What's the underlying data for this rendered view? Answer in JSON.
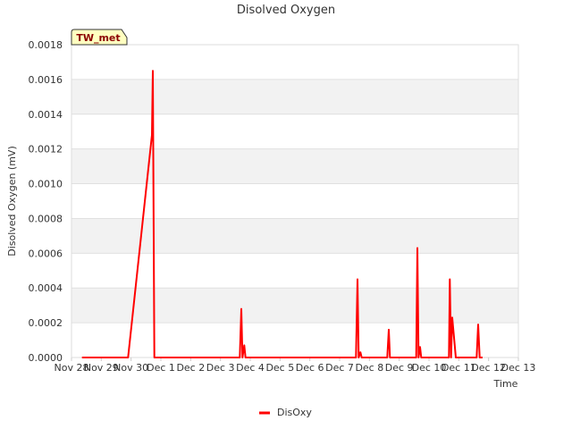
{
  "chart_data": {
    "type": "line",
    "title": "Disolved Oxygen",
    "xlabel": "Time",
    "ylabel": "Disolved Oxygen (mV)",
    "ylim": [
      0,
      0.0018
    ],
    "yticks": [
      "0.0000",
      "0.0002",
      "0.0004",
      "0.0006",
      "0.0008",
      "0.0010",
      "0.0012",
      "0.0014",
      "0.0016",
      "0.0018"
    ],
    "xlim": [
      0,
      15
    ],
    "xticks": [
      "Nov 28",
      "Nov 29",
      "Nov 30",
      "Dec 1",
      "Dec 2",
      "Dec 3",
      "Dec 4",
      "Dec 5",
      "Dec 6",
      "Dec 7",
      "Dec 8",
      "Dec 9",
      "Dec 10",
      "Dec 11",
      "Dec 12",
      "Dec 13"
    ],
    "grid": true,
    "band_color": "#f2f2f2",
    "legend_position": "bottom-center",
    "site_badge": "TW_met",
    "series": [
      {
        "name": "DisOxy",
        "color": "#ff0000",
        "points": [
          [
            0.35,
            0
          ],
          [
            1.9,
            0
          ],
          [
            2.7,
            0.00128
          ],
          [
            2.73,
            0.00165
          ],
          [
            2.78,
            0
          ],
          [
            5.65,
            0
          ],
          [
            5.7,
            0.00028
          ],
          [
            5.74,
            0
          ],
          [
            5.8,
            7e-05
          ],
          [
            5.84,
            0
          ],
          [
            9.55,
            0
          ],
          [
            9.6,
            0.00045
          ],
          [
            9.64,
            0
          ],
          [
            9.7,
            3e-05
          ],
          [
            9.74,
            0
          ],
          [
            10.6,
            0
          ],
          [
            10.65,
            0.00016
          ],
          [
            10.69,
            0
          ],
          [
            11.57,
            0
          ],
          [
            11.61,
            0.00063
          ],
          [
            11.65,
            0
          ],
          [
            11.7,
            6e-05
          ],
          [
            11.74,
            0
          ],
          [
            12.67,
            0
          ],
          [
            12.7,
            0.00045
          ],
          [
            12.74,
            0
          ],
          [
            12.78,
            0.00023
          ],
          [
            12.9,
            0
          ],
          [
            13.6,
            0
          ],
          [
            13.65,
            0.00019
          ],
          [
            13.7,
            0
          ],
          [
            13.8,
            0
          ]
        ]
      }
    ]
  }
}
